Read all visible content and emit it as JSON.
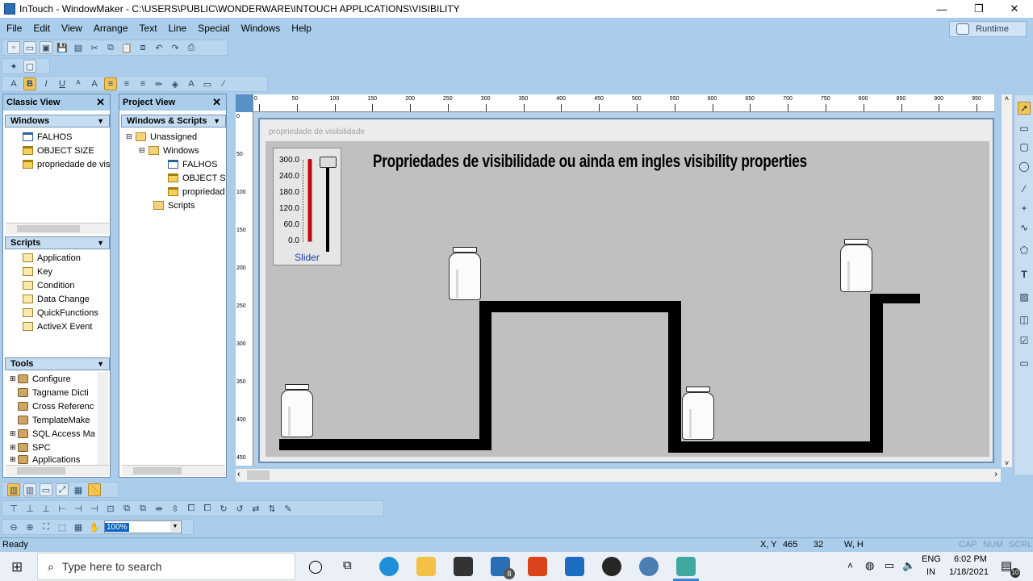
{
  "window": {
    "title": "InTouch - WindowMaker - C:\\USERS\\PUBLIC\\WONDERWARE\\INTOUCH APPLICATIONS\\VISIBILITY",
    "minimize": "—",
    "maximize": "❐",
    "close": "✕"
  },
  "menu": [
    "File",
    "Edit",
    "View",
    "Arrange",
    "Text",
    "Line",
    "Special",
    "Windows",
    "Help"
  ],
  "runtime_label": "Runtime",
  "classic_view": {
    "title": "Classic View",
    "windows_section": "Windows",
    "windows": [
      "FALHOS",
      "OBJECT SIZE",
      "propriedade de vis"
    ],
    "scripts_section": "Scripts",
    "scripts": [
      "Application",
      "Key",
      "Condition",
      "Data Change",
      "QuickFunctions",
      "ActiveX Event"
    ],
    "tools_section": "Tools",
    "tools": [
      "Configure",
      "Tagname Dicti",
      "Cross Referenc",
      "TemplateMake",
      "SQL Access Ma",
      "SPC",
      "Applications"
    ]
  },
  "project_view": {
    "title": "Project View",
    "section": "Windows & Scripts",
    "tree": [
      "Unassigned",
      "Windows",
      "FALHOS",
      "OBJECT SIZ",
      "propriedad",
      "Scripts"
    ]
  },
  "ruler": {
    "h_ticks": [
      "0",
      "50",
      "100",
      "150",
      "200",
      "250",
      "300",
      "350",
      "400",
      "450",
      "500",
      "550",
      "600",
      "650",
      "700",
      "750",
      "800",
      "850",
      "900",
      "950"
    ],
    "v_ticks": [
      "0",
      "50",
      "100",
      "150",
      "200",
      "250",
      "300",
      "350",
      "400",
      "450"
    ]
  },
  "canvas_window": {
    "caption": "propriedade de visibilidade",
    "headline": "Propriedades de visibilidade ou ainda em ingles visibility properties",
    "slider": {
      "scale": [
        "300.0",
        "240.0",
        "180.0",
        "120.0",
        "60.0",
        "0.0"
      ],
      "label": "Slider",
      "level_fraction": 1.0
    }
  },
  "zoom": "100%",
  "status": {
    "ready": "Ready",
    "xy_label": "X, Y",
    "x": "465",
    "y": "32",
    "wh_label": "W, H",
    "cap": "CAP",
    "num": "NUM",
    "scrl": "SCRL"
  },
  "taskbar": {
    "search_placeholder": "Type here to search",
    "lang_top": "ENG",
    "lang_bottom": "IN",
    "time": "6:02 PM",
    "date": "1/18/2021",
    "mail_badge": "8",
    "notif_badge": "10"
  },
  "colors": {
    "chrome": "#a9cdea",
    "canvas": "#c0c0c0",
    "pipe": "#000000",
    "slider_fill": "#d40000"
  }
}
